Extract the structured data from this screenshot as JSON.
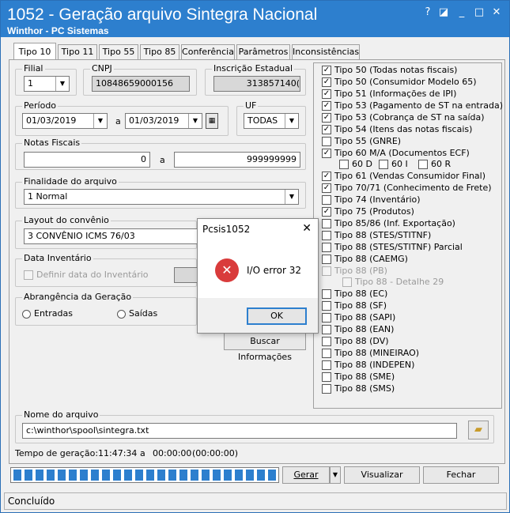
{
  "window": {
    "title": "1052 - Geração arquivo Sintegra Nacional",
    "subtitle": "Winthor - PC Sistemas",
    "close_glyph": "✕"
  },
  "tabs": [
    {
      "label": "Tipo 10"
    },
    {
      "label": "Tipo 11"
    },
    {
      "label": "Tipo 55"
    },
    {
      "label": "Tipo 85"
    },
    {
      "label": "Conferência"
    },
    {
      "label": "Parâmetros"
    },
    {
      "label": "Inconsistências"
    }
  ],
  "filial": {
    "label": "Filial",
    "value": "1"
  },
  "cnpj": {
    "label": "CNPJ",
    "value": "10848659000156"
  },
  "inscricao": {
    "label": "Inscrição Estadual",
    "value": "313857140("
  },
  "periodo": {
    "label": "Período",
    "from": "01/03/2019",
    "sep": "a",
    "to": "01/03/2019"
  },
  "uf": {
    "label": "UF",
    "value": "TODAS"
  },
  "notas": {
    "label": "Notas Fiscais",
    "from": "0",
    "sep": "a",
    "to": "999999999"
  },
  "finalidade": {
    "label": "Finalidade do arquivo",
    "value": "1 Normal"
  },
  "layout": {
    "label": "Layout do convênio",
    "value": "3 CONVÊNIO ICMS 76/03"
  },
  "data_inventario": {
    "label": "Data Inventário",
    "checkbox_label": "Definir data do Inventário"
  },
  "abrangencia": {
    "label": "Abrangência da Geração",
    "entradas": "Entradas",
    "saidas": "Saídas"
  },
  "buscar_button": "Buscar Informações",
  "checklist": [
    {
      "label": "Tipo 50 (Todas notas fiscais)",
      "checked": true
    },
    {
      "label": "Tipo 50 (Consumidor Modelo 65)",
      "checked": true
    },
    {
      "label": "Tipo 51 (Informações de IPI)",
      "checked": true
    },
    {
      "label": "Tipo 53 (Pagamento de ST na entrada)",
      "checked": true
    },
    {
      "label": "Tipo 53 (Cobrança de ST na saída)",
      "checked": true
    },
    {
      "label": "Tipo 54 (Itens das notas fiscais)",
      "checked": true
    },
    {
      "label": "Tipo 55 (GNRE)",
      "checked": false
    },
    {
      "label": "Tipo 60 M/A (Documentos ECF)",
      "checked": true
    }
  ],
  "sub60": [
    "60 D",
    "60 I",
    "60 R"
  ],
  "checklist2": [
    {
      "label": "Tipo 61 (Vendas Consumidor Final)",
      "checked": true
    },
    {
      "label": "Tipo 70/71 (Conhecimento de Frete)",
      "checked": true
    },
    {
      "label": "Tipo 74 (Inventário)",
      "checked": false
    },
    {
      "label": "Tipo 75 (Produtos)",
      "checked": true
    },
    {
      "label": "Tipo 85/86 (Inf. Exportação)",
      "checked": false
    },
    {
      "label": "Tipo 88 (STES/STITNF)",
      "checked": false
    },
    {
      "label": "Tipo 88 (STES/STITNF) Parcial",
      "checked": false
    },
    {
      "label": "Tipo 88 (CAEMG)",
      "checked": false
    }
  ],
  "disabled_items": [
    "Tipo 88 (PB)",
    "Tipo 88 - Detalhe 29"
  ],
  "checklist3": [
    {
      "label": "Tipo 88 (EC)",
      "checked": false
    },
    {
      "label": "Tipo 88 (SF)",
      "checked": false
    },
    {
      "label": "Tipo 88 (SAPI)",
      "checked": false
    },
    {
      "label": "Tipo 88 (EAN)",
      "checked": false
    },
    {
      "label": "Tipo 88 (DV)",
      "checked": false
    },
    {
      "label": "Tipo 88 (MINEIRAO)",
      "checked": false
    },
    {
      "label": "Tipo 88 (INDEPEN)",
      "checked": false
    },
    {
      "label": "Tipo 88 (SME)",
      "checked": false
    },
    {
      "label": "Tipo 88 (SMS)",
      "checked": false
    }
  ],
  "arquivo": {
    "label": "Nome do arquivo",
    "value": "c:\\winthor\\spool\\sintegra.txt"
  },
  "tempo": {
    "label": "Tempo de geração:",
    "start": "11:47:34",
    "sep": "a",
    "end": "00:00:00",
    "elapsed": "(00:00:00)"
  },
  "buttons": {
    "gerar": "Gerar",
    "visualizar": "Visualizar",
    "fechar": "Fechar"
  },
  "status": "Concluído",
  "dialog": {
    "title": "Pcsis1052",
    "message": "I/O error 32",
    "ok": "OK"
  },
  "colors": {
    "title_blue": "#2d7fce",
    "error_red": "#d93b3b"
  }
}
